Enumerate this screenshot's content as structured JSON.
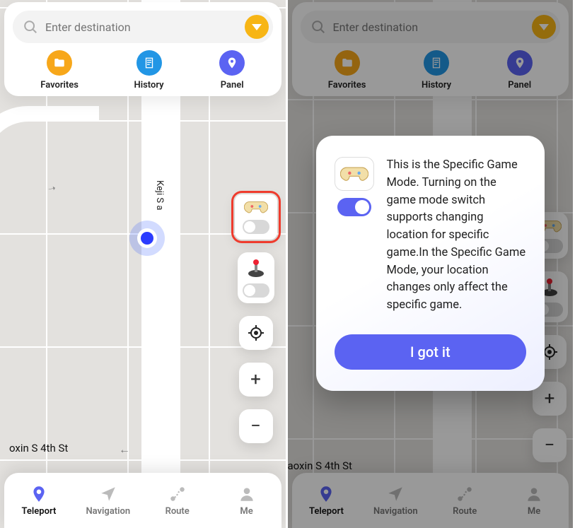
{
  "search": {
    "placeholder": "Enter destination"
  },
  "shortcuts": {
    "favorites": "Favorites",
    "history": "History",
    "panel": "Panel"
  },
  "streets": {
    "vertical": "Keji S a",
    "bottom_left": "oxin S 4th St",
    "bottom_right": "aoxin S 4th St"
  },
  "side_controls": {
    "game_mode_toggle_on": false,
    "joystick_toggle_on": false
  },
  "nav": {
    "teleport": "Teleport",
    "navigation": "Navigation",
    "route": "Route",
    "me": "Me",
    "active": "teleport"
  },
  "modal": {
    "text": "This is the Specific Game Mode. Turning on the game mode switch supports changing location for specific game.In the Specific Game Mode, your location changes only affect the specific game.",
    "button": "I got it",
    "toggle_on": true
  }
}
